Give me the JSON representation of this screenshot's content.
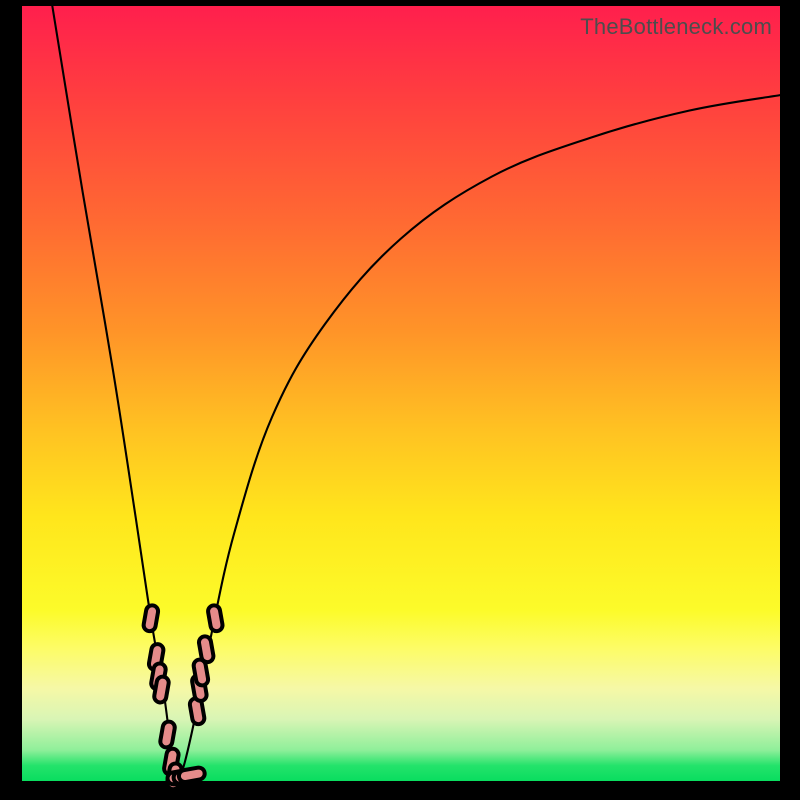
{
  "watermark": "TheBottleneck.com",
  "chart_data": {
    "type": "line",
    "title": "",
    "xlabel": "",
    "ylabel": "",
    "xlim": [
      0,
      100
    ],
    "ylim": [
      0,
      100
    ],
    "grid": false,
    "legend": false,
    "series": [
      {
        "name": "left-branch",
        "x": [
          4,
          8,
          12,
          15,
          17,
          18.6,
          19.3,
          19.8,
          20.2,
          20.6
        ],
        "y": [
          100,
          76,
          53,
          34,
          21,
          12,
          7,
          3.5,
          1.2,
          0
        ],
        "color": "#000000"
      },
      {
        "name": "right-branch",
        "x": [
          20.6,
          21.5,
          23,
          25,
          28,
          33,
          40,
          50,
          62,
          75,
          88,
          100
        ],
        "y": [
          0,
          2.5,
          9,
          19,
          32,
          47,
          59,
          70,
          78,
          83,
          86.5,
          88.5
        ],
        "color": "#000000"
      }
    ],
    "markers": {
      "name": "data-points",
      "color": "#e58b8a",
      "shape": "rounded-capsule",
      "points": [
        {
          "x": 17.0,
          "y": 21.0
        },
        {
          "x": 17.7,
          "y": 16.0
        },
        {
          "x": 18.0,
          "y": 13.5
        },
        {
          "x": 18.4,
          "y": 11.8
        },
        {
          "x": 19.2,
          "y": 6.0
        },
        {
          "x": 19.7,
          "y": 2.5
        },
        {
          "x": 20.1,
          "y": 0.6
        },
        {
          "x": 20.9,
          "y": 0.5
        },
        {
          "x": 21.7,
          "y": 0.6
        },
        {
          "x": 22.4,
          "y": 0.8
        },
        {
          "x": 23.1,
          "y": 9.0
        },
        {
          "x": 23.4,
          "y": 12.0
        },
        {
          "x": 23.6,
          "y": 14.0
        },
        {
          "x": 24.3,
          "y": 17.0
        },
        {
          "x": 25.5,
          "y": 21.0
        }
      ]
    }
  }
}
